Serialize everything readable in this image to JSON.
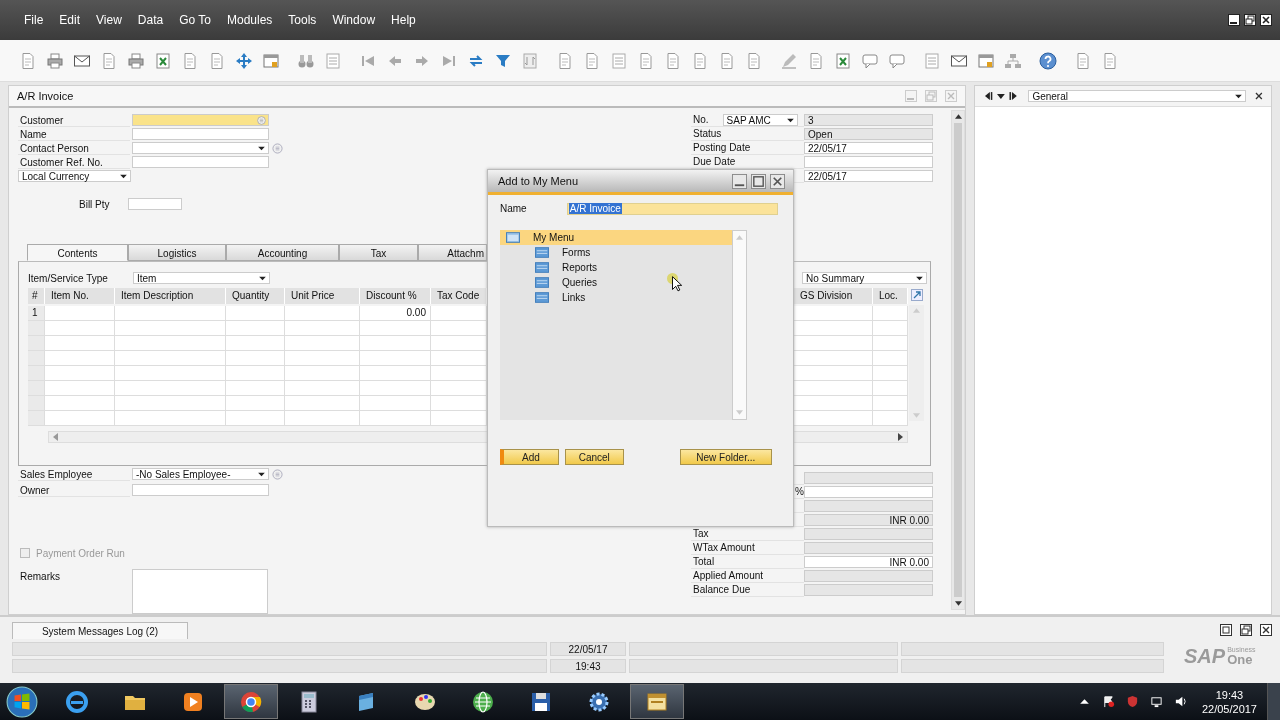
{
  "menu": [
    "File",
    "Edit",
    "View",
    "Data",
    "Go To",
    "Modules",
    "Tools",
    "Window",
    "Help"
  ],
  "form": {
    "title": "A/R Invoice",
    "header_fields": [
      {
        "label": "Customer",
        "kind": "lookup",
        "focused": true
      },
      {
        "label": "Name",
        "kind": "text",
        "focused": false
      },
      {
        "label": "Contact Person",
        "kind": "dropdown",
        "focused": false
      },
      {
        "label": "Customer Ref. No.",
        "kind": "text",
        "focused": false
      }
    ],
    "currency": "Local Currency",
    "bill_pty": {
      "label": "Bill Pty"
    },
    "doc_fields": [
      {
        "label": "No.",
        "series": "SAP AMC",
        "value": "3",
        "readonly": true
      },
      {
        "label": "Status",
        "value": "Open",
        "readonly": true
      },
      {
        "label": "Posting Date",
        "value": "22/05/17",
        "readonly": false
      },
      {
        "label": "Due Date",
        "readonly": false
      },
      {
        "value": "22/05/17",
        "readonly": false
      }
    ],
    "tabs": [
      {
        "label": "Contents",
        "selected": true
      },
      {
        "label": "Logistics",
        "selected": false
      },
      {
        "label": "Accounting",
        "selected": false
      },
      {
        "label": "Tax",
        "selected": false
      },
      {
        "label": "Attachm",
        "selected": false
      }
    ],
    "item_type": {
      "label": "Item/Service Type",
      "value": "Item"
    },
    "summary": "No Summary",
    "table": {
      "columns": [
        "#",
        "Item No.",
        "Item Description",
        "Quantity",
        "Unit Price",
        "Discount %",
        "Tax Code",
        "GS Division",
        "Loc."
      ],
      "rows": [
        {
          "number": "1",
          "discount": "0.00"
        }
      ]
    },
    "sales_employee": {
      "label": "Sales Employee",
      "value": "-No Sales Employee-"
    },
    "owner": {
      "label": "Owner"
    },
    "payment_order_run": {
      "label": "Payment Order Run",
      "checked": false,
      "disabled": true
    },
    "remarks": {
      "label": "Remarks"
    },
    "totals": [
      {
        "readonly": true
      },
      {
        "label": "%",
        "label_cut": true,
        "readonly": false
      },
      {
        "readonly": true
      },
      {
        "value": "INR 0.00",
        "readonly": true
      },
      {
        "label": "Tax",
        "label_cut": false,
        "readonly": true
      },
      {
        "label": "WTax Amount",
        "label_cut": false,
        "readonly": true
      },
      {
        "label": "Total",
        "label_cut": false,
        "value": "INR 0.00",
        "readonly": false
      },
      {
        "label": "Applied Amount",
        "label_cut": false,
        "readonly": true
      },
      {
        "label": "Balance Due",
        "label_cut": false,
        "readonly": true
      }
    ]
  },
  "side_panel": {
    "view": "General"
  },
  "dialog": {
    "title": "Add to My Menu",
    "name_label": "Name",
    "name_value": "A/R Invoice",
    "name_selected": true,
    "tree": {
      "label": "My Menu",
      "selected": true,
      "children": [
        {
          "label": "Forms",
          "selected": false
        },
        {
          "label": "Reports",
          "selected": false
        },
        {
          "label": "Queries",
          "selected": false
        },
        {
          "label": "Links",
          "selected": false
        }
      ]
    },
    "buttons": [
      {
        "label": "Add",
        "kind": "default"
      },
      {
        "label": "Cancel",
        "kind": "normal"
      },
      {
        "label": "New Folder...",
        "kind": "normal"
      }
    ]
  },
  "bottom_tab": "System Messages Log (2)",
  "status_bar": {
    "date": "22/05/17",
    "time": "19:43"
  },
  "logo": {
    "brand": "SAP",
    "line1": "Business",
    "line2": "One"
  },
  "taskbar": {
    "time": "19:43",
    "date": "22/05/2017"
  }
}
